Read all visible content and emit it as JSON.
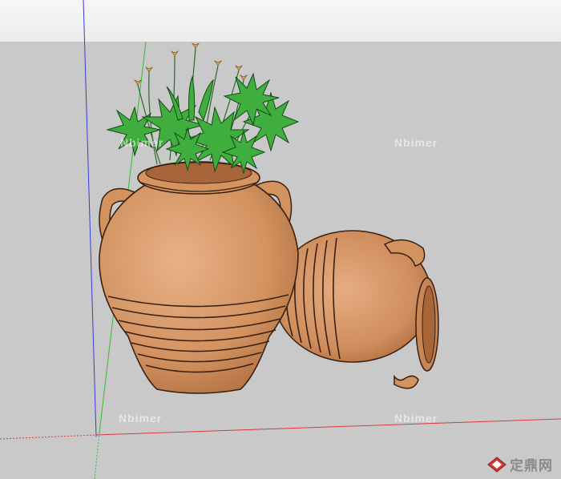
{
  "scene": {
    "sky_color": "#f3f3f3",
    "ground_color": "#c9c9c9",
    "axis_colors": {
      "blue": "#3a3ad8",
      "green": "#2fbf2f",
      "red": "#d63a3a"
    },
    "pot_color": "#d89a6a",
    "pot_shadow": "#b5774a",
    "leaf_color": "#3fae3f",
    "flower_color": "#e6a54a"
  },
  "watermarks": [
    "Nbimer",
    "Nbimer",
    "Nbimer",
    "Nbimer"
  ],
  "brand": {
    "text": "定鼎网",
    "icon": "diamond-logo-icon"
  }
}
